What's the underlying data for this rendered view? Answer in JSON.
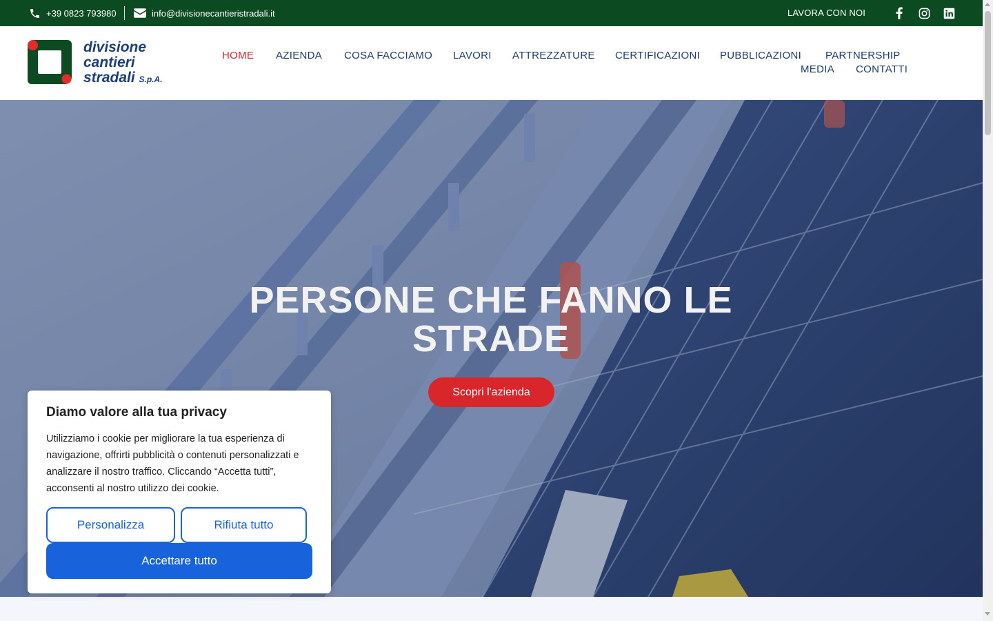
{
  "topbar": {
    "phone": "+39 0823 793980",
    "email": "info@divisionecantieristradali.it",
    "work_with_us": "LAVORA CON NOI",
    "social_icons": [
      "facebook-icon",
      "instagram-icon",
      "linkedin-icon"
    ]
  },
  "logo": {
    "line1": "divisione",
    "line2": "cantieri",
    "line3": "stradali",
    "suffix": "S.p.A."
  },
  "nav": {
    "items": [
      "HOME",
      "AZIENDA",
      "COSA FACCIAMO",
      "LAVORI",
      "ATTREZZATURE",
      "CERTIFICAZIONI",
      "PUBBLICAZIONI",
      "PARTNERSHIP",
      "MEDIA",
      "CONTATTI"
    ],
    "active": "HOME"
  },
  "hero": {
    "title": "PERSONE CHE FANNO LE STRADE",
    "button": "Scopri l'azienda"
  },
  "cookie": {
    "title": "Diamo valore alla tua privacy",
    "text": "Utilizziamo i cookie per migliorare la tua esperienza di navigazione, offrirti pubblicità o contenuti personalizzati e analizzare il nostro traffico. Cliccando “Accetta tutti”, acconsenti al nostro utilizzo dei cookie.",
    "customize": "Personalizza",
    "reject": "Rifiuta tutto",
    "accept": "Accettare tutto"
  },
  "colors": {
    "brand_green": "#0c4a22",
    "brand_red": "#d8262b",
    "brand_blue": "#1c3f7a",
    "cookie_blue": "#1863dc"
  }
}
